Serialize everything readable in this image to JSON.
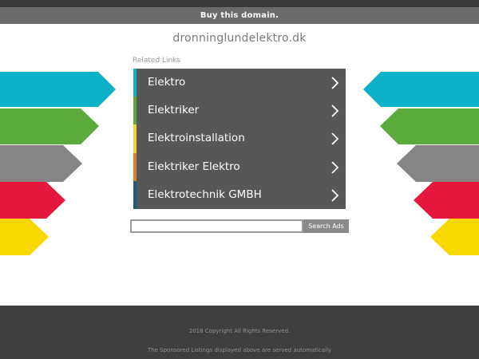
{
  "header": {
    "buy_label": "Buy this domain.",
    "domain": "dronninglundelektro.dk"
  },
  "related": {
    "title": "Related Links",
    "links": [
      {
        "label": "Elektro",
        "accent": "#0bb0c9"
      },
      {
        "label": "Elektriker",
        "accent": "#5aab3c"
      },
      {
        "label": "Elektroinstallation",
        "accent": "#f5d12b"
      },
      {
        "label": "Elektriker Elektro",
        "accent": "#e87a2d"
      },
      {
        "label": "Elektrotechnik GMBH",
        "accent": "#1e5c7a"
      }
    ]
  },
  "search": {
    "button_label": "Search Ads",
    "value": ""
  },
  "decor": {
    "arrow_colors": [
      "#0bb0c9",
      "#5aab3c",
      "#858585",
      "#e5173d",
      "#f9d800"
    ]
  },
  "footer": {
    "copyright": "2018 Copyright All Rights Reserved.",
    "sponsored": "The Sponsored Listings displayed above are served automatically"
  }
}
